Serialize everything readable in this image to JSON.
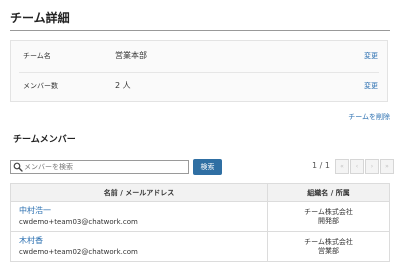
{
  "page": {
    "title": "チーム詳細"
  },
  "team_info": {
    "rows": [
      {
        "label": "チーム名",
        "value": "営業本部",
        "edit_label": "変更"
      },
      {
        "label": "メンバー数",
        "value": "2 人",
        "edit_label": "変更"
      }
    ]
  },
  "delete_team_label": "チームを削除",
  "members_section": {
    "title": "チームメンバー",
    "search": {
      "placeholder": "メンバーを検索",
      "value": "",
      "icon": "search-icon",
      "button_label": "検索"
    },
    "pagination": {
      "counter": "1 / 1",
      "buttons": [
        "«",
        "‹",
        "›",
        "»"
      ]
    },
    "table": {
      "headers": [
        "名前 / メールアドレス",
        "組織名 / 所属"
      ],
      "rows": [
        {
          "name": "中村浩一",
          "email": "cwdemo+team03@chatwork.com",
          "org": "チーム株式会社",
          "dept": "開発部"
        },
        {
          "name": "木村香",
          "email": "cwdemo+team02@chatwork.com",
          "org": "チーム株式会社",
          "dept": "営業部"
        }
      ]
    }
  },
  "colors": {
    "link": "#2a6fb0",
    "primary_button": "#2f6fa3",
    "header_bg": "#f2f2f2"
  }
}
